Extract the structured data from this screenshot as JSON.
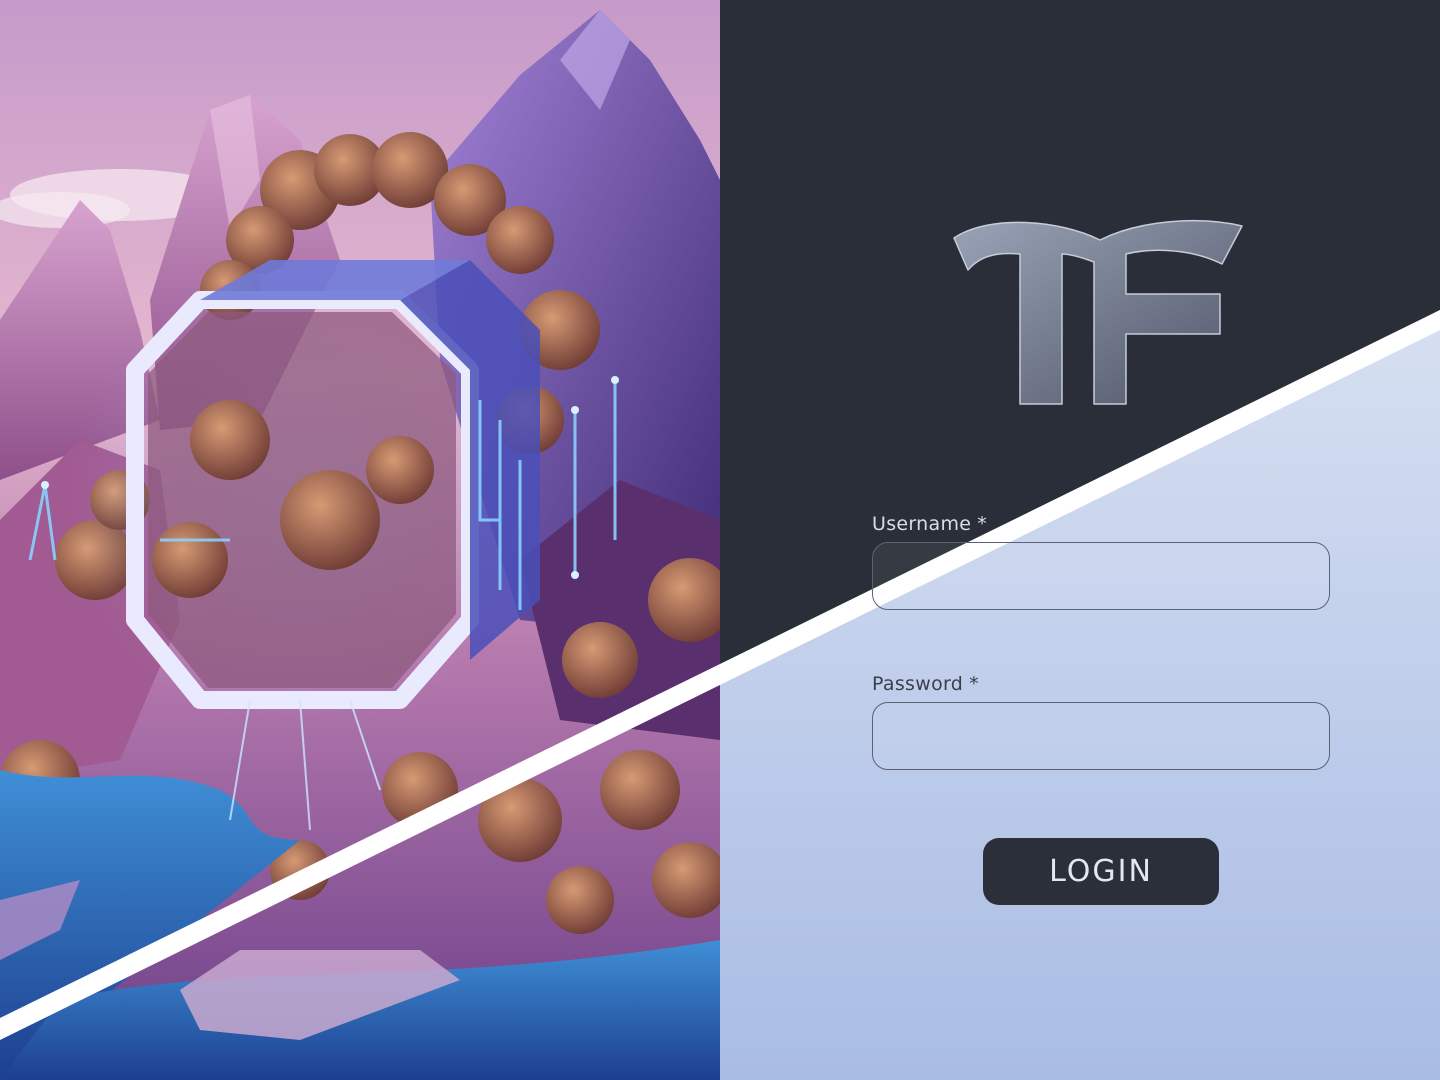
{
  "brand": {
    "logo_text": "TF"
  },
  "form": {
    "username": {
      "label": "Username",
      "required_mark": "*",
      "value": ""
    },
    "password": {
      "label": "Password",
      "required_mark": "*",
      "value": ""
    },
    "login_label": "LOGIN"
  },
  "colors": {
    "panel_dark": "#2a2e38",
    "panel_light_top": "#e9eef8",
    "panel_light_bottom": "#a9bce4",
    "button_bg": "#2b2f3a",
    "button_text": "#e3e7ef",
    "accent_glow": "#6aa8ff"
  },
  "icons": {
    "hero": "fantasy-portal-illustration",
    "logo": "tf-monogram"
  }
}
